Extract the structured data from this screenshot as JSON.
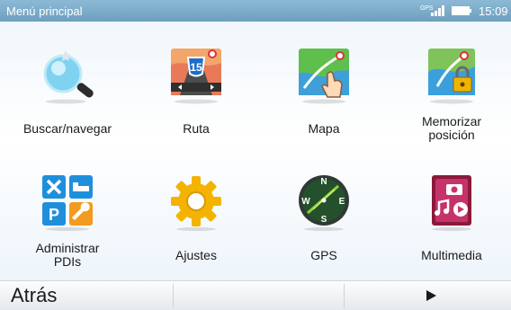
{
  "status_bar": {
    "title": "Menú principal",
    "gps_label": "GPS",
    "clock": "15:09"
  },
  "menu": {
    "items": [
      {
        "label": "Buscar/navegar",
        "icon": "magnifier-search-icon"
      },
      {
        "label": "Ruta",
        "icon": "route-map-icon"
      },
      {
        "label": "Mapa",
        "icon": "map-touch-icon"
      },
      {
        "label": "Memorizar\nposición",
        "icon": "save-position-icon"
      },
      {
        "label": "Administrar\nPDIs",
        "icon": "poi-grid-icon"
      },
      {
        "label": "Ajustes",
        "icon": "gear-icon"
      },
      {
        "label": "GPS",
        "icon": "compass-icon"
      },
      {
        "label": "Multimedia",
        "icon": "multimedia-icon"
      }
    ]
  },
  "bottom_bar": {
    "back_label": "Atrás"
  },
  "colors": {
    "status_bar": "#7aaac8",
    "gear": "#f3b300",
    "poi_blue": "#1f8fdc"
  }
}
